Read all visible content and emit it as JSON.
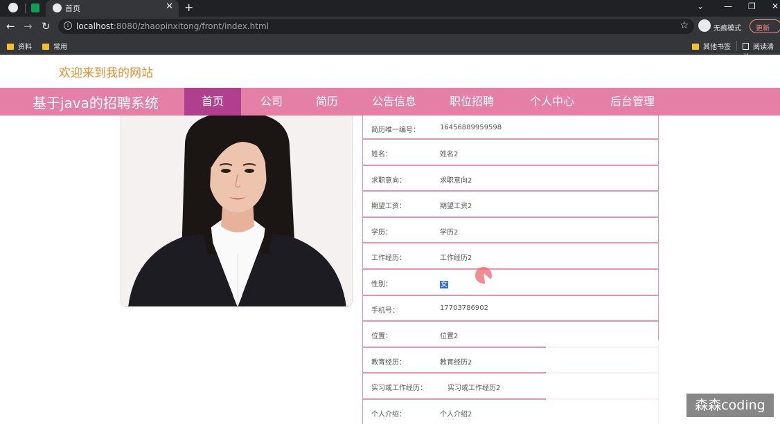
{
  "browser": {
    "tab_title": "首页",
    "url_host": "localhost",
    "url_rest": ":8080/zhaopinxitong/front/index.html",
    "incognito_label": "无痕模式",
    "update_label": "更新",
    "bookmarks": [
      "资料",
      "常用"
    ],
    "bookmarks_right": [
      "其他书签",
      "阅读清单"
    ]
  },
  "site": {
    "welcome": "欢迎来到我的网站",
    "brand": "基于java的招聘系统",
    "nav": [
      "首页",
      "公司",
      "简历",
      "公告信息",
      "职位招聘",
      "个人中心",
      "后台管理"
    ]
  },
  "resume": {
    "rows": [
      {
        "label": "简历唯一编号：",
        "value": "16456889959598"
      },
      {
        "label": "姓名：",
        "value": "姓名2"
      },
      {
        "label": "求职意向：",
        "value": "求职意向2"
      },
      {
        "label": "期望工资：",
        "value": "期望工资2"
      },
      {
        "label": "学历：",
        "value": "学历2"
      },
      {
        "label": "工作经历：",
        "value": "工作经历2"
      },
      {
        "label": "性别：",
        "value": "女"
      },
      {
        "label": "手机号：",
        "value": "17703786902"
      },
      {
        "label": "位置：",
        "value": "位置2"
      },
      {
        "label": "教育经历：",
        "value": "教育经历2"
      },
      {
        "label": "实习或工作经历：",
        "value": "实习或工作经历2"
      },
      {
        "label": "个人介绍：",
        "value": "个人介绍2"
      }
    ]
  },
  "watermark": "森森coding",
  "colors": {
    "navbar": "#e57fa5",
    "nav_active": "#b0408f",
    "welcome": "#e88f32",
    "table_border": "#ec8fb3"
  }
}
